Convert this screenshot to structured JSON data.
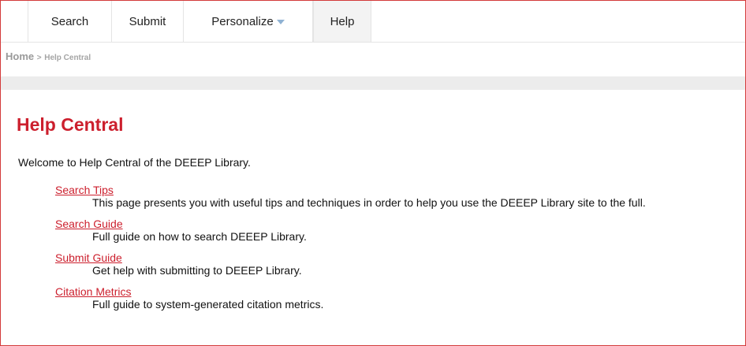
{
  "nav": {
    "tabs": [
      {
        "label": "Search"
      },
      {
        "label": "Submit"
      },
      {
        "label": "Personalize"
      },
      {
        "label": "Help"
      }
    ]
  },
  "breadcrumb": {
    "home": "Home",
    "separator": ">",
    "current": "Help Central"
  },
  "main": {
    "title": "Help Central",
    "intro": "Welcome to Help Central of the DEEEP Library.",
    "items": [
      {
        "link": "Search Tips",
        "description": "This page presents you with useful tips and techniques in order to help you use the DEEEP Library site to the full."
      },
      {
        "link": "Search Guide",
        "description": "Full guide on how to search DEEEP Library."
      },
      {
        "link": "Submit Guide",
        "description": "Get help with submitting to DEEEP Library."
      },
      {
        "link": "Citation Metrics",
        "description": "Full guide to system-generated citation metrics."
      }
    ]
  },
  "colors": {
    "accent": "#cc1f2d",
    "border": "#d33a3a",
    "caret": "#8fb2d3"
  }
}
